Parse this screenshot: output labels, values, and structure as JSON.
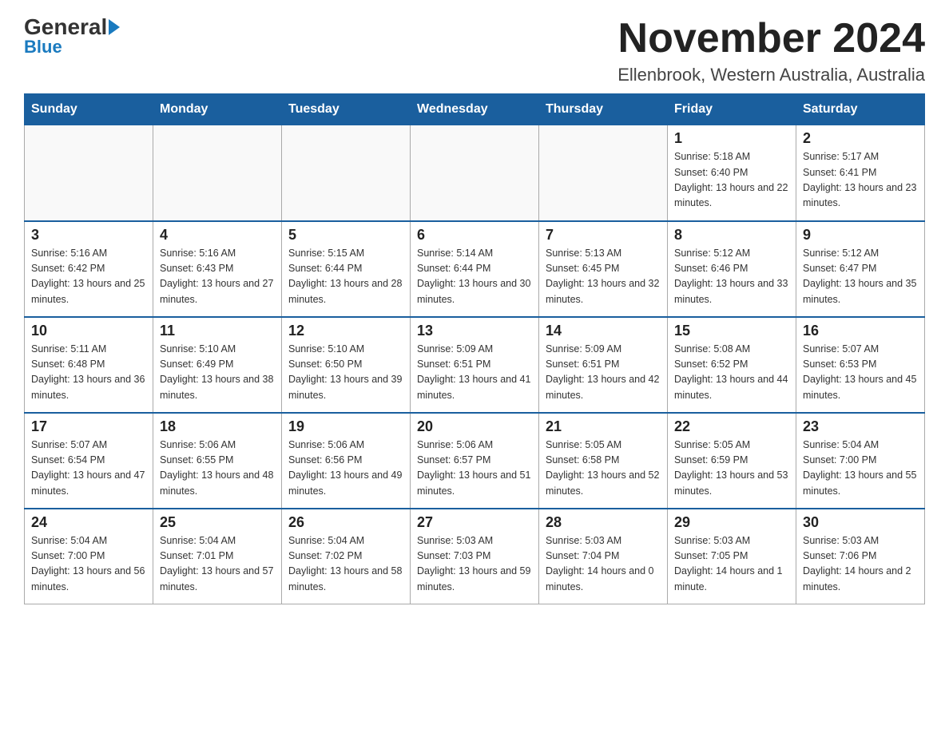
{
  "logo": {
    "text_general": "General",
    "triangle_color": "#1a7abf",
    "text_blue": "Blue"
  },
  "header": {
    "month_title": "November 2024",
    "location": "Ellenbrook, Western Australia, Australia"
  },
  "weekdays": [
    "Sunday",
    "Monday",
    "Tuesday",
    "Wednesday",
    "Thursday",
    "Friday",
    "Saturday"
  ],
  "weeks": [
    [
      {
        "day": "",
        "sunrise": "",
        "sunset": "",
        "daylight": ""
      },
      {
        "day": "",
        "sunrise": "",
        "sunset": "",
        "daylight": ""
      },
      {
        "day": "",
        "sunrise": "",
        "sunset": "",
        "daylight": ""
      },
      {
        "day": "",
        "sunrise": "",
        "sunset": "",
        "daylight": ""
      },
      {
        "day": "",
        "sunrise": "",
        "sunset": "",
        "daylight": ""
      },
      {
        "day": "1",
        "sunrise": "Sunrise: 5:18 AM",
        "sunset": "Sunset: 6:40 PM",
        "daylight": "Daylight: 13 hours and 22 minutes."
      },
      {
        "day": "2",
        "sunrise": "Sunrise: 5:17 AM",
        "sunset": "Sunset: 6:41 PM",
        "daylight": "Daylight: 13 hours and 23 minutes."
      }
    ],
    [
      {
        "day": "3",
        "sunrise": "Sunrise: 5:16 AM",
        "sunset": "Sunset: 6:42 PM",
        "daylight": "Daylight: 13 hours and 25 minutes."
      },
      {
        "day": "4",
        "sunrise": "Sunrise: 5:16 AM",
        "sunset": "Sunset: 6:43 PM",
        "daylight": "Daylight: 13 hours and 27 minutes."
      },
      {
        "day": "5",
        "sunrise": "Sunrise: 5:15 AM",
        "sunset": "Sunset: 6:44 PM",
        "daylight": "Daylight: 13 hours and 28 minutes."
      },
      {
        "day": "6",
        "sunrise": "Sunrise: 5:14 AM",
        "sunset": "Sunset: 6:44 PM",
        "daylight": "Daylight: 13 hours and 30 minutes."
      },
      {
        "day": "7",
        "sunrise": "Sunrise: 5:13 AM",
        "sunset": "Sunset: 6:45 PM",
        "daylight": "Daylight: 13 hours and 32 minutes."
      },
      {
        "day": "8",
        "sunrise": "Sunrise: 5:12 AM",
        "sunset": "Sunset: 6:46 PM",
        "daylight": "Daylight: 13 hours and 33 minutes."
      },
      {
        "day": "9",
        "sunrise": "Sunrise: 5:12 AM",
        "sunset": "Sunset: 6:47 PM",
        "daylight": "Daylight: 13 hours and 35 minutes."
      }
    ],
    [
      {
        "day": "10",
        "sunrise": "Sunrise: 5:11 AM",
        "sunset": "Sunset: 6:48 PM",
        "daylight": "Daylight: 13 hours and 36 minutes."
      },
      {
        "day": "11",
        "sunrise": "Sunrise: 5:10 AM",
        "sunset": "Sunset: 6:49 PM",
        "daylight": "Daylight: 13 hours and 38 minutes."
      },
      {
        "day": "12",
        "sunrise": "Sunrise: 5:10 AM",
        "sunset": "Sunset: 6:50 PM",
        "daylight": "Daylight: 13 hours and 39 minutes."
      },
      {
        "day": "13",
        "sunrise": "Sunrise: 5:09 AM",
        "sunset": "Sunset: 6:51 PM",
        "daylight": "Daylight: 13 hours and 41 minutes."
      },
      {
        "day": "14",
        "sunrise": "Sunrise: 5:09 AM",
        "sunset": "Sunset: 6:51 PM",
        "daylight": "Daylight: 13 hours and 42 minutes."
      },
      {
        "day": "15",
        "sunrise": "Sunrise: 5:08 AM",
        "sunset": "Sunset: 6:52 PM",
        "daylight": "Daylight: 13 hours and 44 minutes."
      },
      {
        "day": "16",
        "sunrise": "Sunrise: 5:07 AM",
        "sunset": "Sunset: 6:53 PM",
        "daylight": "Daylight: 13 hours and 45 minutes."
      }
    ],
    [
      {
        "day": "17",
        "sunrise": "Sunrise: 5:07 AM",
        "sunset": "Sunset: 6:54 PM",
        "daylight": "Daylight: 13 hours and 47 minutes."
      },
      {
        "day": "18",
        "sunrise": "Sunrise: 5:06 AM",
        "sunset": "Sunset: 6:55 PM",
        "daylight": "Daylight: 13 hours and 48 minutes."
      },
      {
        "day": "19",
        "sunrise": "Sunrise: 5:06 AM",
        "sunset": "Sunset: 6:56 PM",
        "daylight": "Daylight: 13 hours and 49 minutes."
      },
      {
        "day": "20",
        "sunrise": "Sunrise: 5:06 AM",
        "sunset": "Sunset: 6:57 PM",
        "daylight": "Daylight: 13 hours and 51 minutes."
      },
      {
        "day": "21",
        "sunrise": "Sunrise: 5:05 AM",
        "sunset": "Sunset: 6:58 PM",
        "daylight": "Daylight: 13 hours and 52 minutes."
      },
      {
        "day": "22",
        "sunrise": "Sunrise: 5:05 AM",
        "sunset": "Sunset: 6:59 PM",
        "daylight": "Daylight: 13 hours and 53 minutes."
      },
      {
        "day": "23",
        "sunrise": "Sunrise: 5:04 AM",
        "sunset": "Sunset: 7:00 PM",
        "daylight": "Daylight: 13 hours and 55 minutes."
      }
    ],
    [
      {
        "day": "24",
        "sunrise": "Sunrise: 5:04 AM",
        "sunset": "Sunset: 7:00 PM",
        "daylight": "Daylight: 13 hours and 56 minutes."
      },
      {
        "day": "25",
        "sunrise": "Sunrise: 5:04 AM",
        "sunset": "Sunset: 7:01 PM",
        "daylight": "Daylight: 13 hours and 57 minutes."
      },
      {
        "day": "26",
        "sunrise": "Sunrise: 5:04 AM",
        "sunset": "Sunset: 7:02 PM",
        "daylight": "Daylight: 13 hours and 58 minutes."
      },
      {
        "day": "27",
        "sunrise": "Sunrise: 5:03 AM",
        "sunset": "Sunset: 7:03 PM",
        "daylight": "Daylight: 13 hours and 59 minutes."
      },
      {
        "day": "28",
        "sunrise": "Sunrise: 5:03 AM",
        "sunset": "Sunset: 7:04 PM",
        "daylight": "Daylight: 14 hours and 0 minutes."
      },
      {
        "day": "29",
        "sunrise": "Sunrise: 5:03 AM",
        "sunset": "Sunset: 7:05 PM",
        "daylight": "Daylight: 14 hours and 1 minute."
      },
      {
        "day": "30",
        "sunrise": "Sunrise: 5:03 AM",
        "sunset": "Sunset: 7:06 PM",
        "daylight": "Daylight: 14 hours and 2 minutes."
      }
    ]
  ]
}
